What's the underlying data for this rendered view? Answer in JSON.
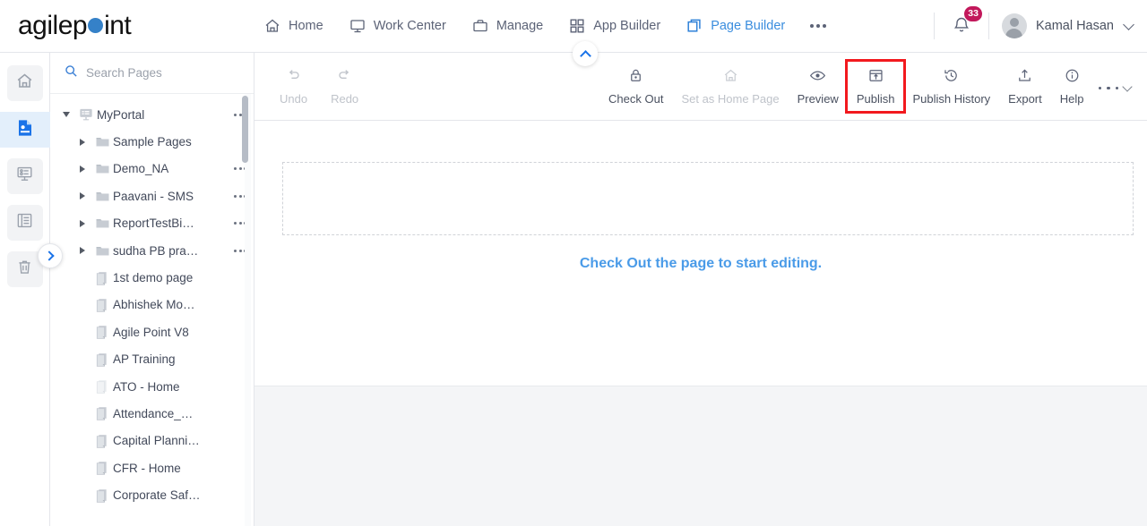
{
  "brand": {
    "name": "agilepoint",
    "accent": "#3581c8"
  },
  "topnav": {
    "items": [
      {
        "label": "Home",
        "icon": "home-icon",
        "active": false
      },
      {
        "label": "Work Center",
        "icon": "monitor-icon",
        "active": false
      },
      {
        "label": "Manage",
        "icon": "briefcase-icon",
        "active": false
      },
      {
        "label": "App Builder",
        "icon": "grid-icon",
        "active": false
      },
      {
        "label": "Page Builder",
        "icon": "pages-icon",
        "active": true
      }
    ],
    "more_label": "more-options",
    "notifications": {
      "count": "33",
      "icon": "bell-icon"
    },
    "user": {
      "name": "Kamal Hasan",
      "icon": "avatar"
    }
  },
  "rail": {
    "items": [
      {
        "name": "home-icon",
        "active": false
      },
      {
        "name": "page-icon",
        "active": true
      },
      {
        "name": "form-icon",
        "active": false
      },
      {
        "name": "list-icon",
        "active": false
      },
      {
        "name": "trash-icon",
        "active": false
      }
    ],
    "expand_icon": "chevron-right-icon"
  },
  "sidebar": {
    "search": {
      "placeholder": "Search Pages",
      "value": "",
      "icon": "search-icon"
    },
    "tree": [
      {
        "label": "MyPortal",
        "type": "portal",
        "depth": 0,
        "expanded": true,
        "menu": true
      },
      {
        "label": "Sample Pages",
        "type": "folder",
        "depth": 1,
        "expanded": false,
        "menu": false
      },
      {
        "label": "Demo_NA",
        "type": "folder",
        "depth": 1,
        "expanded": false,
        "menu": true
      },
      {
        "label": "Paavani - SMS",
        "type": "folder",
        "depth": 1,
        "expanded": false,
        "menu": true
      },
      {
        "label": "ReportTestBi…",
        "type": "folder",
        "depth": 1,
        "expanded": false,
        "menu": true
      },
      {
        "label": "sudha PB pra…",
        "type": "folder",
        "depth": 1,
        "expanded": false,
        "menu": true
      },
      {
        "label": "1st demo page",
        "type": "page",
        "depth": 1,
        "expanded": false,
        "menu": false
      },
      {
        "label": "Abhishek Mo…",
        "type": "page",
        "depth": 1,
        "expanded": false,
        "menu": false
      },
      {
        "label": "Agile Point V8",
        "type": "page",
        "depth": 1,
        "expanded": false,
        "menu": false
      },
      {
        "label": "AP Training",
        "type": "page",
        "depth": 1,
        "expanded": false,
        "menu": false
      },
      {
        "label": "ATO - Home",
        "type": "page-faded",
        "depth": 1,
        "expanded": false,
        "menu": false
      },
      {
        "label": "Attendance_…",
        "type": "page",
        "depth": 1,
        "expanded": false,
        "menu": false
      },
      {
        "label": "Capital Planni…",
        "type": "page",
        "depth": 1,
        "expanded": false,
        "menu": false
      },
      {
        "label": "CFR - Home",
        "type": "page",
        "depth": 1,
        "expanded": false,
        "menu": false
      },
      {
        "label": "Corporate Saf…",
        "type": "page",
        "depth": 1,
        "expanded": false,
        "menu": false
      }
    ]
  },
  "toolbar": {
    "collapse_icon": "chevron-up-icon",
    "left": [
      {
        "label": "Undo",
        "icon": "undo-icon",
        "disabled": true
      },
      {
        "label": "Redo",
        "icon": "redo-icon",
        "disabled": true
      }
    ],
    "right": [
      {
        "label": "Check Out",
        "icon": "lock-icon",
        "disabled": false,
        "highlighted": false
      },
      {
        "label": "Set as Home Page",
        "icon": "home-icon",
        "disabled": true,
        "highlighted": false
      },
      {
        "label": "Preview",
        "icon": "eye-icon",
        "disabled": false,
        "highlighted": false
      },
      {
        "label": "Publish",
        "icon": "publish-icon",
        "disabled": false,
        "highlighted": true
      },
      {
        "label": "Publish History",
        "icon": "history-icon",
        "disabled": false,
        "highlighted": false
      },
      {
        "label": "Export",
        "icon": "export-icon",
        "disabled": false,
        "highlighted": false
      },
      {
        "label": "Help",
        "icon": "info-icon",
        "disabled": false,
        "highlighted": false
      }
    ],
    "overflow_icon": "more-chevron-icon",
    "highlight_color": "#f2191e"
  },
  "canvas": {
    "message": "Check Out the page to start editing.",
    "message_color": "#4a9be8"
  }
}
